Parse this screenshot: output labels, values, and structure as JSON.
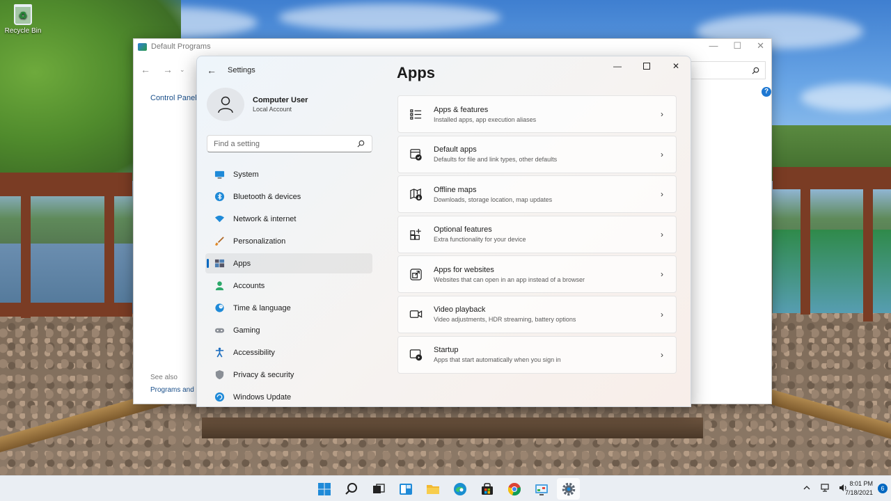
{
  "desktop": {
    "recycle_bin_label": "Recycle Bin"
  },
  "default_programs": {
    "title": "Default Programs",
    "control_panel_link": "Control Panel",
    "see_also": "See also",
    "programs_link": "Programs and"
  },
  "settings": {
    "window_title": "Settings",
    "user": {
      "name": "Computer User",
      "account": "Local Account"
    },
    "search": {
      "placeholder": "Find a setting"
    },
    "page_heading": "Apps",
    "nav": [
      {
        "label": "System",
        "icon": "monitor-icon"
      },
      {
        "label": "Bluetooth & devices",
        "icon": "bluetooth-icon"
      },
      {
        "label": "Network & internet",
        "icon": "wifi-icon"
      },
      {
        "label": "Personalization",
        "icon": "brush-icon"
      },
      {
        "label": "Apps",
        "icon": "apps-icon",
        "selected": true
      },
      {
        "label": "Accounts",
        "icon": "person-icon"
      },
      {
        "label": "Time & language",
        "icon": "globe-clock-icon"
      },
      {
        "label": "Gaming",
        "icon": "gamepad-icon"
      },
      {
        "label": "Accessibility",
        "icon": "accessibility-icon"
      },
      {
        "label": "Privacy & security",
        "icon": "shield-icon"
      },
      {
        "label": "Windows Update",
        "icon": "refresh-icon"
      }
    ],
    "cards": [
      {
        "title": "Apps & features",
        "description": "Installed apps, app execution aliases",
        "icon": "list-icon"
      },
      {
        "title": "Default apps",
        "description": "Defaults for file and link types, other defaults",
        "icon": "default-apps-icon"
      },
      {
        "title": "Offline maps",
        "description": "Downloads, storage location, map updates",
        "icon": "map-icon"
      },
      {
        "title": "Optional features",
        "description": "Extra functionality for your device",
        "icon": "grid-plus-icon"
      },
      {
        "title": "Apps for websites",
        "description": "Websites that can open in an app instead of a browser",
        "icon": "open-external-icon"
      },
      {
        "title": "Video playback",
        "description": "Video adjustments, HDR streaming, battery options",
        "icon": "video-camera-icon"
      },
      {
        "title": "Startup",
        "description": "Apps that start automatically when you sign in",
        "icon": "startup-icon"
      }
    ]
  },
  "taskbar": {
    "time": "8:01 PM",
    "date": "7/18/2021",
    "notification_count": "6",
    "accent_color": "#0067c0"
  }
}
